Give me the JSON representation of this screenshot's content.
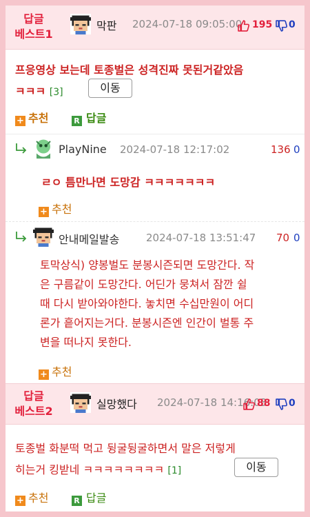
{
  "comments": [
    {
      "badge_line1": "답글",
      "badge_line2": "베스트1",
      "author": "막판",
      "date": "2024-07-18 09:05:00",
      "up": "195",
      "down": "0",
      "text_line1": "프응영상 보는데 토종벌은 성격진짜 못된거같았음",
      "text_line2": "ㅋㅋㅋ",
      "reply_count": "[3]",
      "move_label": "이동",
      "recommend_label": "추천",
      "reply_label": "답글"
    },
    {
      "badge_line1": "답글",
      "badge_line2": "베스트2",
      "author": "실망했다",
      "date": "2024-07-18 14:16:03",
      "up": "88",
      "down": "0",
      "text_line1": "토종벌 화분떡 먹고 뒹굴뒹굴하면서 말은 저렇게",
      "text_line2": "히는거 킹받네 ㅋㅋㅋㅋㅋㅋㅋㅋ",
      "reply_count": "[1]",
      "move_label": "이동",
      "recommend_label": "추천",
      "reply_label": "답글"
    }
  ],
  "replies": [
    {
      "author": "PlayNine",
      "date": "2024-07-18 12:17:02",
      "up": "136",
      "down": "0",
      "text": "ㄹㅇ 틈만나면 도망감 ㅋㅋㅋㅋㅋㅋㅋ",
      "recommend_label": "추천"
    },
    {
      "author": "안내메일발송",
      "date": "2024-07-18 13:51:47",
      "up": "70",
      "down": "0",
      "lines": [
        "토막상식) 양봉벌도 분봉시즌되면 도망간다. 작",
        "은 구름같이 도망간다. 어딘가 뭉쳐서 잠깐 쉴",
        "때 다시 받아와야한다. 놓치면 수십만원이 어디",
        "론가 흩어지는거다. 분봉시즌엔 인간이 벌통 주",
        "변을 떠나지 못한다."
      ],
      "recommend_label": "추천"
    }
  ],
  "colors": {
    "accent_red": "#e2203c",
    "text_red": "#cc2222",
    "down_blue": "#1f3fbf",
    "best_bg": "#fde6e9",
    "frame_pink": "#f6c6cc"
  }
}
